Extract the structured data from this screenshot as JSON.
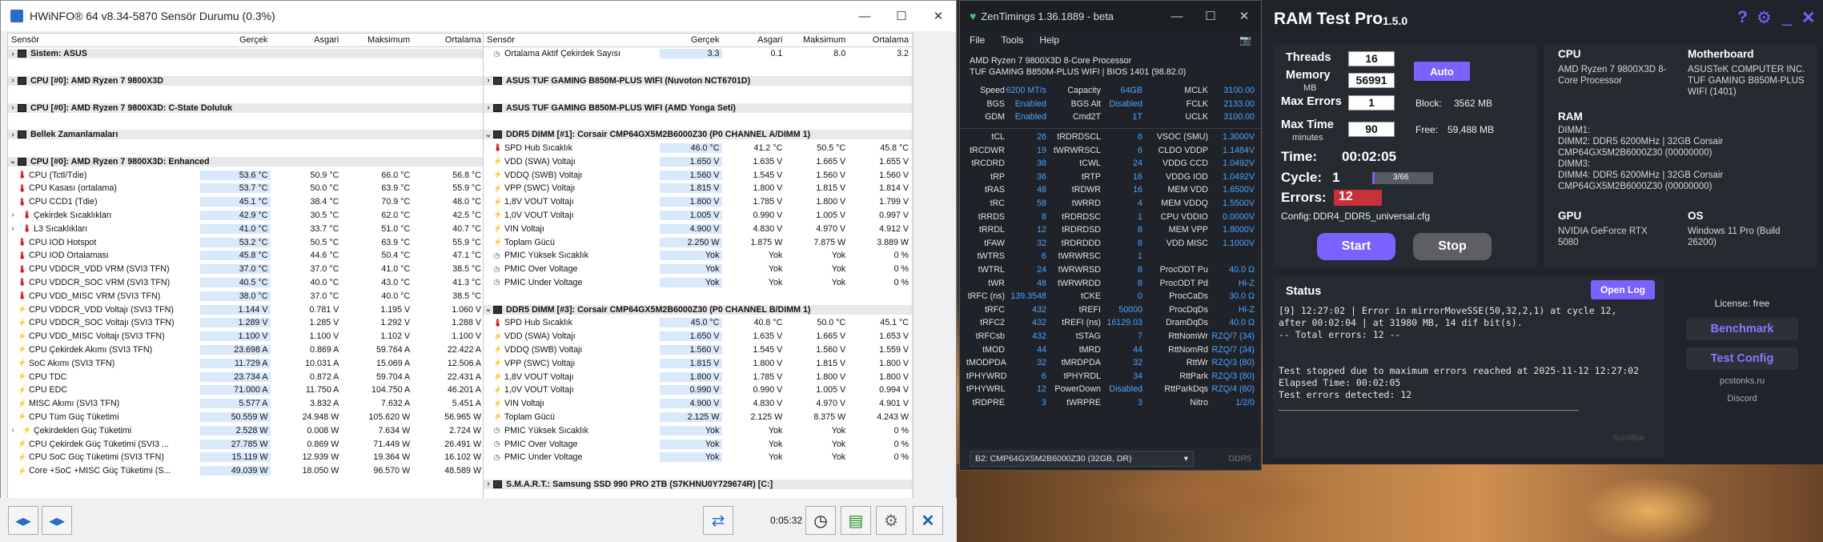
{
  "hwinfo": {
    "title": "HWiNFO® 64 v8.34-5870 Sensör Durumu (0.3%)",
    "columns": [
      "Sensör",
      "Gerçek",
      "Asgari",
      "Maksimum",
      "Ortalama"
    ],
    "left_rows": [
      {
        "kind": "group",
        "name": "Sistem: ASUS"
      },
      {
        "kind": "gap"
      },
      {
        "kind": "group",
        "name": "CPU [#0]: AMD Ryzen 7 9800X3D"
      },
      {
        "kind": "gap"
      },
      {
        "kind": "group",
        "name": "CPU [#0]: AMD Ryzen 7 9800X3D: C-State Doluluk"
      },
      {
        "kind": "gap"
      },
      {
        "kind": "group",
        "name": "Bellek Zamanlamaları"
      },
      {
        "kind": "gap"
      },
      {
        "kind": "group",
        "name": "CPU [#0]: AMD Ryzen 7 9800X3D: Enhanced",
        "open": true
      },
      {
        "icon": "t",
        "name": "CPU (Tctl/Tdie)",
        "v": [
          "53.6 °C",
          "50.9 °C",
          "66.0 °C",
          "56.8 °C"
        ]
      },
      {
        "icon": "t",
        "name": "CPU Kasası (ortalama)",
        "v": [
          "53.7 °C",
          "50.0 °C",
          "63.9 °C",
          "55.9 °C"
        ]
      },
      {
        "icon": "t",
        "name": "CPU CCD1 (Tdie)",
        "v": [
          "45.1 °C",
          "38.4 °C",
          "70.9 °C",
          "48.0 °C"
        ]
      },
      {
        "icon": "t",
        "sub": true,
        "name": "Çekirdek Sıcaklıkları",
        "v": [
          "42.9 °C",
          "30.5 °C",
          "62.0 °C",
          "42.5 °C"
        ]
      },
      {
        "icon": "t",
        "sub": true,
        "name": "L3 Sıcaklıkları",
        "v": [
          "41.0 °C",
          "33.7 °C",
          "51.0 °C",
          "40.7 °C"
        ]
      },
      {
        "icon": "t",
        "name": "CPU IOD Hotspot",
        "v": [
          "53.2 °C",
          "50.5 °C",
          "63.9 °C",
          "55.9 °C"
        ]
      },
      {
        "icon": "t",
        "name": "CPU IOD Ortalaması",
        "v": [
          "45.8 °C",
          "44.6 °C",
          "50.4 °C",
          "47.1 °C"
        ]
      },
      {
        "icon": "t",
        "name": "CPU VDDCR_VDD VRM (SVI3 TFN)",
        "v": [
          "37.0 °C",
          "37.0 °C",
          "41.0 °C",
          "38.5 °C"
        ]
      },
      {
        "icon": "t",
        "name": "CPU VDDCR_SOC VRM (SVI3 TFN)",
        "v": [
          "40.5 °C",
          "40.0 °C",
          "43.0 °C",
          "41.3 °C"
        ]
      },
      {
        "icon": "t",
        "name": "CPU VDD_MISC VRM (SVI3 TFN)",
        "v": [
          "38.0 °C",
          "37.0 °C",
          "40.0 °C",
          "38.5 °C"
        ]
      },
      {
        "icon": "v",
        "name": "CPU VDDCR_VDD Voltajı (SVI3 TFN)",
        "v": [
          "1.144 V",
          "0.781 V",
          "1.195 V",
          "1.060 V"
        ]
      },
      {
        "icon": "v",
        "name": "CPU VDDCR_SOC Voltajı (SVI3 TFN)",
        "v": [
          "1.289 V",
          "1.285 V",
          "1.292 V",
          "1.288 V"
        ]
      },
      {
        "icon": "v",
        "name": "CPU VDD_MISC Voltajı (SVI3 TFN)",
        "v": [
          "1.100 V",
          "1.100 V",
          "1.102 V",
          "1.100 V"
        ]
      },
      {
        "icon": "v",
        "name": "CPU Çekirdek Akımı (SVI3 TFN)",
        "v": [
          "23.698 A",
          "0.869 A",
          "59.764 A",
          "22.422 A"
        ]
      },
      {
        "icon": "v",
        "name": "SoC Akımı (SVI3 TFN)",
        "v": [
          "11.729 A",
          "10.031 A",
          "15.069 A",
          "12.506 A"
        ]
      },
      {
        "icon": "v",
        "name": "CPU TDC",
        "v": [
          "23.734 A",
          "0.872 A",
          "59.704 A",
          "22.431 A"
        ]
      },
      {
        "icon": "v",
        "name": "CPU EDC",
        "v": [
          "71.000 A",
          "11.750 A",
          "104.750 A",
          "46.201 A"
        ]
      },
      {
        "icon": "v",
        "name": "MISC Akımı (SVI3 TFN)",
        "v": [
          "5.577 A",
          "3.832 A",
          "7.632 A",
          "5.451 A"
        ]
      },
      {
        "icon": "v",
        "name": "CPU Tüm Güç Tüketimi",
        "v": [
          "50.559 W",
          "24.948 W",
          "105.620 W",
          "56.965 W"
        ]
      },
      {
        "icon": "v",
        "sub": true,
        "name": "Çekirdekleri Güç Tüketimi",
        "v": [
          "2.528 W",
          "0.008 W",
          "7.634 W",
          "2.724 W"
        ]
      },
      {
        "icon": "v",
        "name": "CPU Çekirdek Güç Tüketimi (SVI3 ...",
        "v": [
          "27.785 W",
          "0.869 W",
          "71.449 W",
          "26.491 W"
        ]
      },
      {
        "icon": "v",
        "name": "CPU SoC Güç Tüketimi (SVI3 TFN)",
        "v": [
          "15.119 W",
          "12.939 W",
          "19.364 W",
          "16.102 W"
        ]
      },
      {
        "icon": "v",
        "name": "Core +SoC +MISC Güç Tüketimi (S...",
        "v": [
          "49.039 W",
          "18.050 W",
          "96.570 W",
          "48.589 W"
        ]
      }
    ],
    "right_rows": [
      {
        "icon": "c",
        "name": "Ortalama Aktif Çekirdek Sayısı",
        "v": [
          "3.3",
          "0.1",
          "8.0",
          "3.2"
        ]
      },
      {
        "kind": "gap"
      },
      {
        "kind": "group",
        "name": "ASUS TUF GAMING B850M-PLUS WIFI (Nuvoton NCT6701D)"
      },
      {
        "kind": "gap"
      },
      {
        "kind": "group",
        "name": "ASUS TUF GAMING B850M-PLUS WIFI (AMD Yonga Seti)"
      },
      {
        "kind": "gap"
      },
      {
        "kind": "group",
        "name": "DDR5 DIMM [#1]: Corsair CMP64GX5M2B6000Z30 (P0 CHANNEL A/DIMM 1)",
        "open": true
      },
      {
        "icon": "t",
        "name": "SPD Hub Sıcaklık",
        "v": [
          "46.0 °C",
          "41.2 °C",
          "50.5 °C",
          "45.8 °C"
        ]
      },
      {
        "icon": "v",
        "name": "VDD (SWA) Voltajı",
        "v": [
          "1.650 V",
          "1.635 V",
          "1.665 V",
          "1.655 V"
        ]
      },
      {
        "icon": "v",
        "name": "VDDQ (SWB) Voltajı",
        "v": [
          "1.560 V",
          "1.545 V",
          "1.560 V",
          "1.560 V"
        ]
      },
      {
        "icon": "v",
        "name": "VPP (SWC) Voltajı",
        "v": [
          "1.815 V",
          "1.800 V",
          "1.815 V",
          "1.814 V"
        ]
      },
      {
        "icon": "v",
        "name": "1,8V VOUT Voltajı",
        "v": [
          "1.800 V",
          "1.785 V",
          "1.800 V",
          "1.799 V"
        ]
      },
      {
        "icon": "v",
        "name": "1,0V VOUT Voltajı",
        "v": [
          "1.005 V",
          "0.990 V",
          "1.005 V",
          "0.997 V"
        ]
      },
      {
        "icon": "v",
        "name": "VIN Voltajı",
        "v": [
          "4.900 V",
          "4.830 V",
          "4.970 V",
          "4.912 V"
        ]
      },
      {
        "icon": "w",
        "name": "Toplam Gücü",
        "v": [
          "2.250 W",
          "1.875 W",
          "7.875 W",
          "3.889 W"
        ]
      },
      {
        "icon": "c",
        "name": "PMIC Yüksek Sıcaklık",
        "v": [
          "Yok",
          "Yok",
          "Yok",
          "0 %"
        ]
      },
      {
        "icon": "c",
        "name": "PMIC Over Voltage",
        "v": [
          "Yok",
          "Yok",
          "Yok",
          "0 %"
        ]
      },
      {
        "icon": "c",
        "name": "PMIC Under Voltage",
        "v": [
          "Yok",
          "Yok",
          "Yok",
          "0 %"
        ]
      },
      {
        "kind": "gap"
      },
      {
        "kind": "group",
        "name": "DDR5 DIMM [#3]: Corsair CMP64GX5M2B6000Z30 (P0 CHANNEL B/DIMM 1)",
        "open": true
      },
      {
        "icon": "t",
        "name": "SPD Hub Sıcaklık",
        "v": [
          "45.0 °C",
          "40.8 °C",
          "50.0 °C",
          "45.1 °C"
        ]
      },
      {
        "icon": "v",
        "name": "VDD (SWA) Voltajı",
        "v": [
          "1.650 V",
          "1.635 V",
          "1.665 V",
          "1.653 V"
        ]
      },
      {
        "icon": "v",
        "name": "VDDQ (SWB) Voltajı",
        "v": [
          "1.560 V",
          "1.545 V",
          "1.560 V",
          "1.559 V"
        ]
      },
      {
        "icon": "v",
        "name": "VPP (SWC) Voltajı",
        "v": [
          "1.815 V",
          "1.800 V",
          "1.815 V",
          "1.800 V"
        ]
      },
      {
        "icon": "v",
        "name": "1,8V VOUT Voltajı",
        "v": [
          "1.800 V",
          "1.785 V",
          "1.800 V",
          "1.800 V"
        ]
      },
      {
        "icon": "v",
        "name": "1,0V VOUT Voltajı",
        "v": [
          "0.990 V",
          "0.990 V",
          "1.005 V",
          "0.994 V"
        ]
      },
      {
        "icon": "v",
        "name": "VIN Voltajı",
        "v": [
          "4.900 V",
          "4.830 V",
          "4.970 V",
          "4.901 V"
        ]
      },
      {
        "icon": "w",
        "name": "Toplam Gücü",
        "v": [
          "2.125 W",
          "2.125 W",
          "8.375 W",
          "4.243 W"
        ]
      },
      {
        "icon": "c",
        "name": "PMIC Yüksek Sıcaklık",
        "v": [
          "Yok",
          "Yok",
          "Yok",
          "0 %"
        ]
      },
      {
        "icon": "c",
        "name": "PMIC Over Voltage",
        "v": [
          "Yok",
          "Yok",
          "Yok",
          "0 %"
        ]
      },
      {
        "icon": "c",
        "name": "PMIC Under Voltage",
        "v": [
          "Yok",
          "Yok",
          "Yok",
          "0 %"
        ]
      },
      {
        "kind": "gap"
      },
      {
        "kind": "group",
        "name": "S.M.A.R.T.: Samsung SSD 990 PRO 2TB (S7KHNU0Y729674R) [C:]"
      }
    ],
    "elapsed": "0:05:32"
  },
  "zentimings": {
    "title": "ZenTimings 1.36.1889 - beta",
    "menu": [
      "File",
      "Tools",
      "Help"
    ],
    "cpu": "AMD Ryzen 7 9800X3D 8-Core Processor",
    "board": "TUF GAMING B850M-PLUS WIFI | BIOS 1401 (98.82.0)",
    "top_rows": [
      [
        "Speed",
        "6200 MT/s",
        "Capacity",
        "64GB",
        "MCLK",
        "3100.00"
      ],
      [
        "BGS",
        "Enabled",
        "BGS Alt",
        "Disabled",
        "FCLK",
        "2133.00"
      ],
      [
        "GDM",
        "Enabled",
        "Cmd2T",
        "1T",
        "UCLK",
        "3100.00"
      ]
    ],
    "rows": [
      [
        "tCL",
        "26",
        "tRDRDSCL",
        "6",
        "VSOC (SMU)",
        "1.3000V"
      ],
      [
        "tRCDWR",
        "19",
        "tWRWRSCL",
        "6",
        "CLDO VDDP",
        "1.1484V"
      ],
      [
        "tRCDRD",
        "38",
        "tCWL",
        "24",
        "VDDG CCD",
        "1.0492V"
      ],
      [
        "tRP",
        "36",
        "tRTP",
        "16",
        "VDDG IOD",
        "1.0492V"
      ],
      [
        "tRAS",
        "48",
        "tRDWR",
        "16",
        "MEM VDD",
        "1.6500V"
      ],
      [
        "tRC",
        "58",
        "tWRRD",
        "4",
        "MEM VDDQ",
        "1.5500V"
      ],
      [
        "tRRDS",
        "8",
        "tRDRDSC",
        "1",
        "CPU VDDIO",
        "0.0000V"
      ],
      [
        "tRRDL",
        "12",
        "tRDRDSD",
        "8",
        "MEM VPP",
        "1.8000V"
      ],
      [
        "tFAW",
        "32",
        "tRDRDDD",
        "8",
        "VDD MISC",
        "1.1000V"
      ],
      [
        "tWTRS",
        "6",
        "tWRWRSC",
        "1",
        "",
        ""
      ],
      [
        "tWTRL",
        "24",
        "tWRWRSD",
        "8",
        "ProcODT Pu",
        "40.0 Ω"
      ],
      [
        "tWR",
        "48",
        "tWRWRDD",
        "8",
        "ProcODT Pd",
        "Hi-Z"
      ],
      [
        "tRFC (ns)",
        "139.3548",
        "tCKE",
        "0",
        "ProcCaDs",
        "30.0 Ω"
      ],
      [
        "tRFC",
        "432",
        "tREFI",
        "50000",
        "ProcDqDs",
        "Hi-Z"
      ],
      [
        "tRFC2",
        "432",
        "tREFI (ns)",
        "16129.03",
        "DramDqDs",
        "40.0 Ω"
      ],
      [
        "tRFCsb",
        "432",
        "tSTAG",
        "7",
        "RttNomWr",
        "RZQ/7 (34)"
      ],
      [
        "tMOD",
        "44",
        "tMRD",
        "44",
        "RttNomRd",
        "RZQ/7 (34)"
      ],
      [
        "tMODPDA",
        "32",
        "tMRDPDA",
        "32",
        "RttWr",
        "RZQ/3 (80)"
      ],
      [
        "tPHYWRD",
        "6",
        "tPHYRDL",
        "34",
        "RttPark",
        "RZQ/3 (80)"
      ],
      [
        "tPHYWRL",
        "12",
        "PowerDown",
        "Disabled",
        "RttParkDqs",
        "RZQ/4 (60)"
      ],
      [
        "tRDPRE",
        "3",
        "tWRPRE",
        "3",
        "Nitro",
        "1/2/0"
      ]
    ],
    "module": "B2: CMP64GX5M2B6000Z30 (32GB, DR)",
    "mem_type": "DDR5"
  },
  "ramtest": {
    "title": "RAM Test Pro",
    "version": "1.5.0",
    "threads_label": "Threads",
    "threads": "16",
    "memory_label": "Memory",
    "memory_unit": "MB",
    "memory": "56991",
    "max_errors_label": "Max Errors",
    "max_errors": "1",
    "max_time_label": "Max Time",
    "max_time_unit": "minutes",
    "max_time": "90",
    "auto_label": "Auto",
    "block_label": "Block:",
    "block": "3562 MB",
    "free_label": "Free:",
    "free": "59,488 MB",
    "time_label": "Time:",
    "time": "00:02:05",
    "cycle_label": "Cycle:",
    "cycle": "1",
    "cycle_progress": "3/66",
    "cycle_fraction": 0.045,
    "errors_label": "Errors:",
    "errors": "12",
    "config_label": "Config:",
    "config": "DDR4_DDR5_universal.cfg",
    "start": "Start",
    "stop": "Stop",
    "cpu_h": "CPU",
    "cpu": "AMD Ryzen 7 9800X3D 8-Core Processor",
    "mb_h": "Motherboard",
    "mb": "ASUSTeK COMPUTER INC. TUF GAMING B850M-PLUS WIFI (1401)",
    "ram_h": "RAM",
    "ram_lines": [
      "DIMM1:",
      "DIMM2: DDR5 6200MHz | 32GB Corsair",
      "CMP64GX5M2B6000Z30 (00000000)",
      "DIMM3:",
      "DIMM4: DDR5 6200MHz | 32GB Corsair",
      "CMP64GX5M2B6000Z30 (00000000)"
    ],
    "gpu_h": "GPU",
    "gpu": "NVIDIA GeForce RTX 5080",
    "os_h": "OS",
    "os": "Windows 11 Pro (Build 26200)",
    "status_h": "Status",
    "open_log": "Open Log",
    "status_lines": [
      "[9] 12:27:02 | Error in mirrorMoveSSE(50,32,2,1) at cycle 12,",
      "after 00:02:04 | at 31980 MB, 14 dif bit(s).",
      "-- Total errors: 12 --",
      "",
      "",
      "Test stopped due to maximum errors reached at 2025-11-12 12:27:02",
      "Elapsed Time: 00:02:05",
      "Test errors detected: 12"
    ],
    "scrollbar": "Scrollbar",
    "license": "License: free",
    "benchmark": "Benchmark",
    "test_config": "Test Config",
    "site": "pcstonks.ru",
    "discord": "Discord",
    "accent": "#7b61ff",
    "error_color": "#c8303a"
  }
}
